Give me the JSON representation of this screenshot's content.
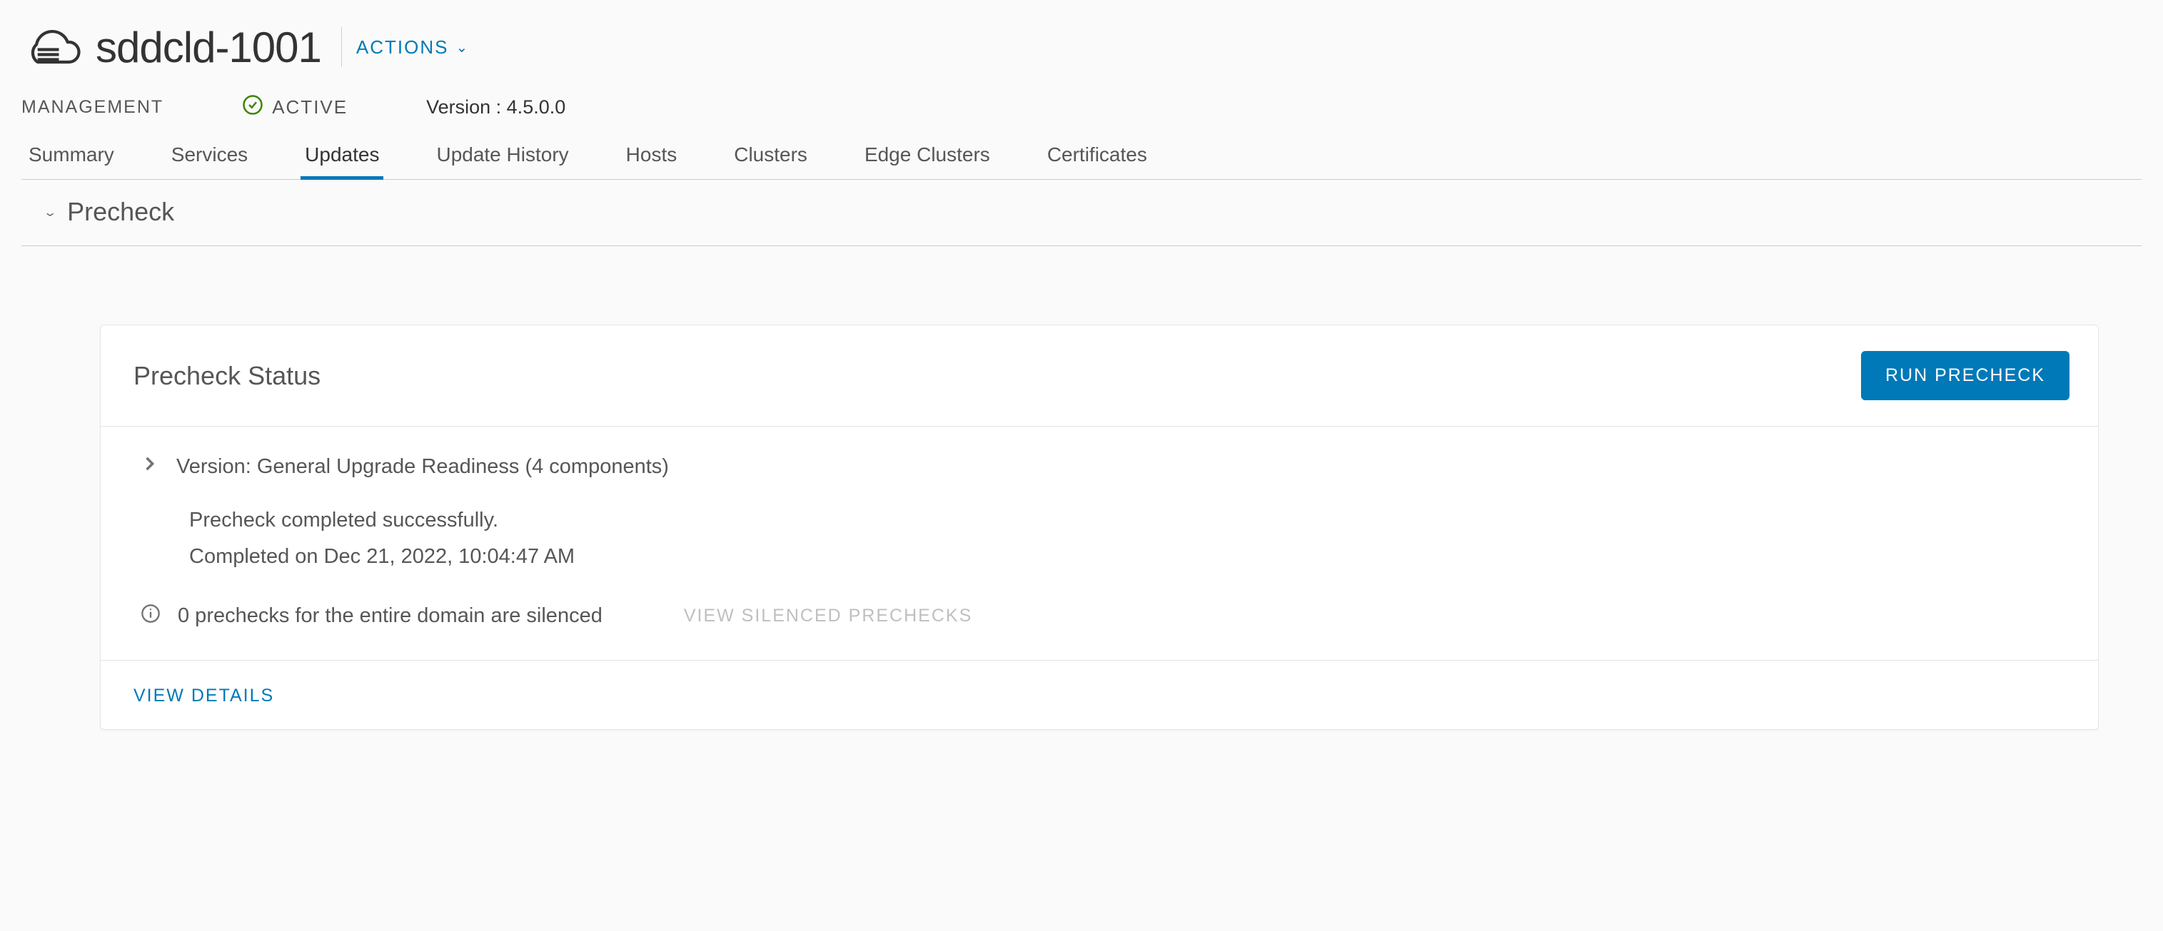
{
  "header": {
    "title": "sddcld-1001",
    "actions_label": "ACTIONS"
  },
  "meta": {
    "management_label": "MANAGEMENT",
    "status_label": "ACTIVE",
    "version_label": "Version : 4.5.0.0"
  },
  "tabs": [
    {
      "label": "Summary",
      "active": false
    },
    {
      "label": "Services",
      "active": false
    },
    {
      "label": "Updates",
      "active": true
    },
    {
      "label": "Update History",
      "active": false
    },
    {
      "label": "Hosts",
      "active": false
    },
    {
      "label": "Clusters",
      "active": false
    },
    {
      "label": "Edge Clusters",
      "active": false
    },
    {
      "label": "Certificates",
      "active": false
    }
  ],
  "section": {
    "title": "Precheck"
  },
  "card": {
    "title": "Precheck Status",
    "run_button": "RUN PRECHECK",
    "version_line": "Version: General Upgrade Readiness (4 components)",
    "status_line": "Precheck completed successfully.",
    "completed_line": "Completed on Dec 21, 2022, 10:04:47 AM",
    "silenced_line": "0 prechecks for the entire domain are silenced",
    "view_silenced": "VIEW SILENCED PRECHECKS",
    "view_details": "VIEW DETAILS"
  }
}
